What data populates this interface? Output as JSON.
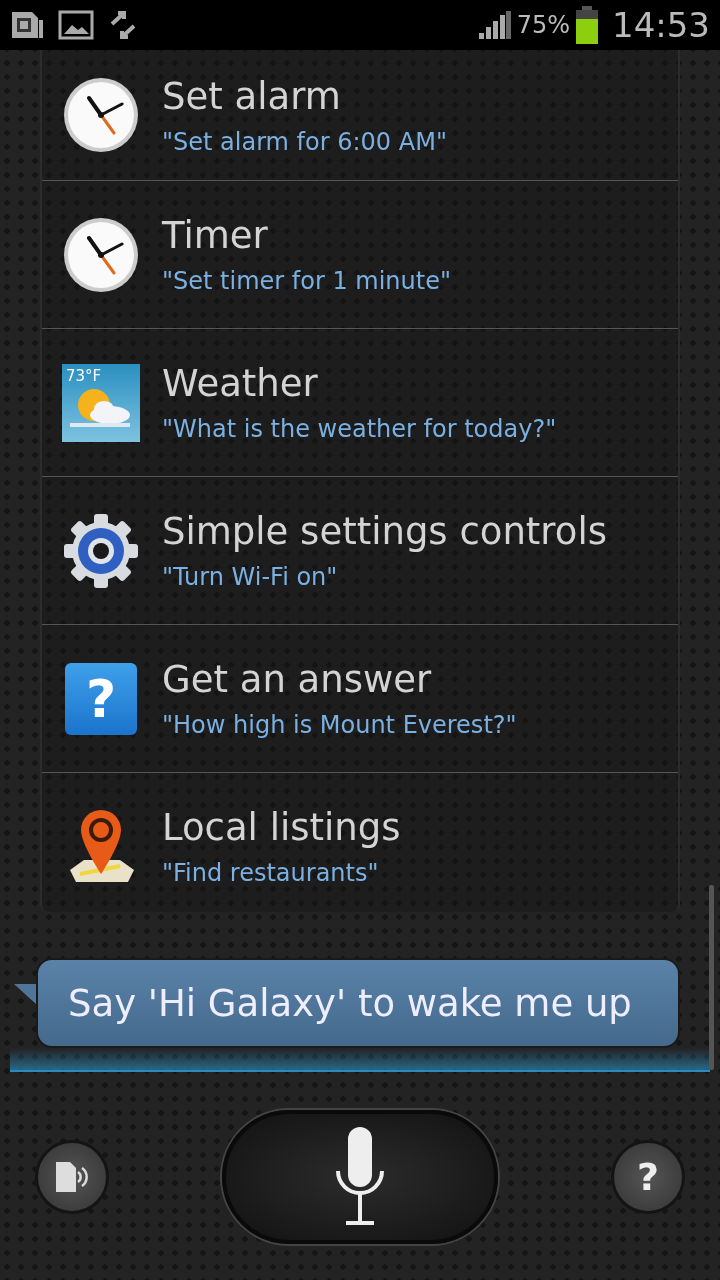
{
  "status_bar": {
    "battery_percent": "75%",
    "battery": {
      "level": 0.75
    },
    "time": "14:53"
  },
  "commands": [
    {
      "kind": "clock",
      "title": "Set alarm",
      "example": "\"Set alarm for 6:00 AM\""
    },
    {
      "kind": "clock",
      "title": "Timer",
      "example": "\"Set timer for 1 minute\""
    },
    {
      "kind": "weather",
      "title": "Weather",
      "example": "\"What is the weather for today?\"",
      "icon_text": "73°F"
    },
    {
      "kind": "gear",
      "title": "Simple settings controls",
      "example": "\"Turn Wi-Fi on\""
    },
    {
      "kind": "question",
      "title": "Get an answer",
      "example": "\"How high is Mount Everest?\"",
      "icon_text": "?"
    },
    {
      "kind": "map",
      "title": "Local listings",
      "example": "\"Find restaurants\""
    }
  ],
  "prompt": "Say 'Hi Galaxy' to wake me up",
  "help_button": "?"
}
